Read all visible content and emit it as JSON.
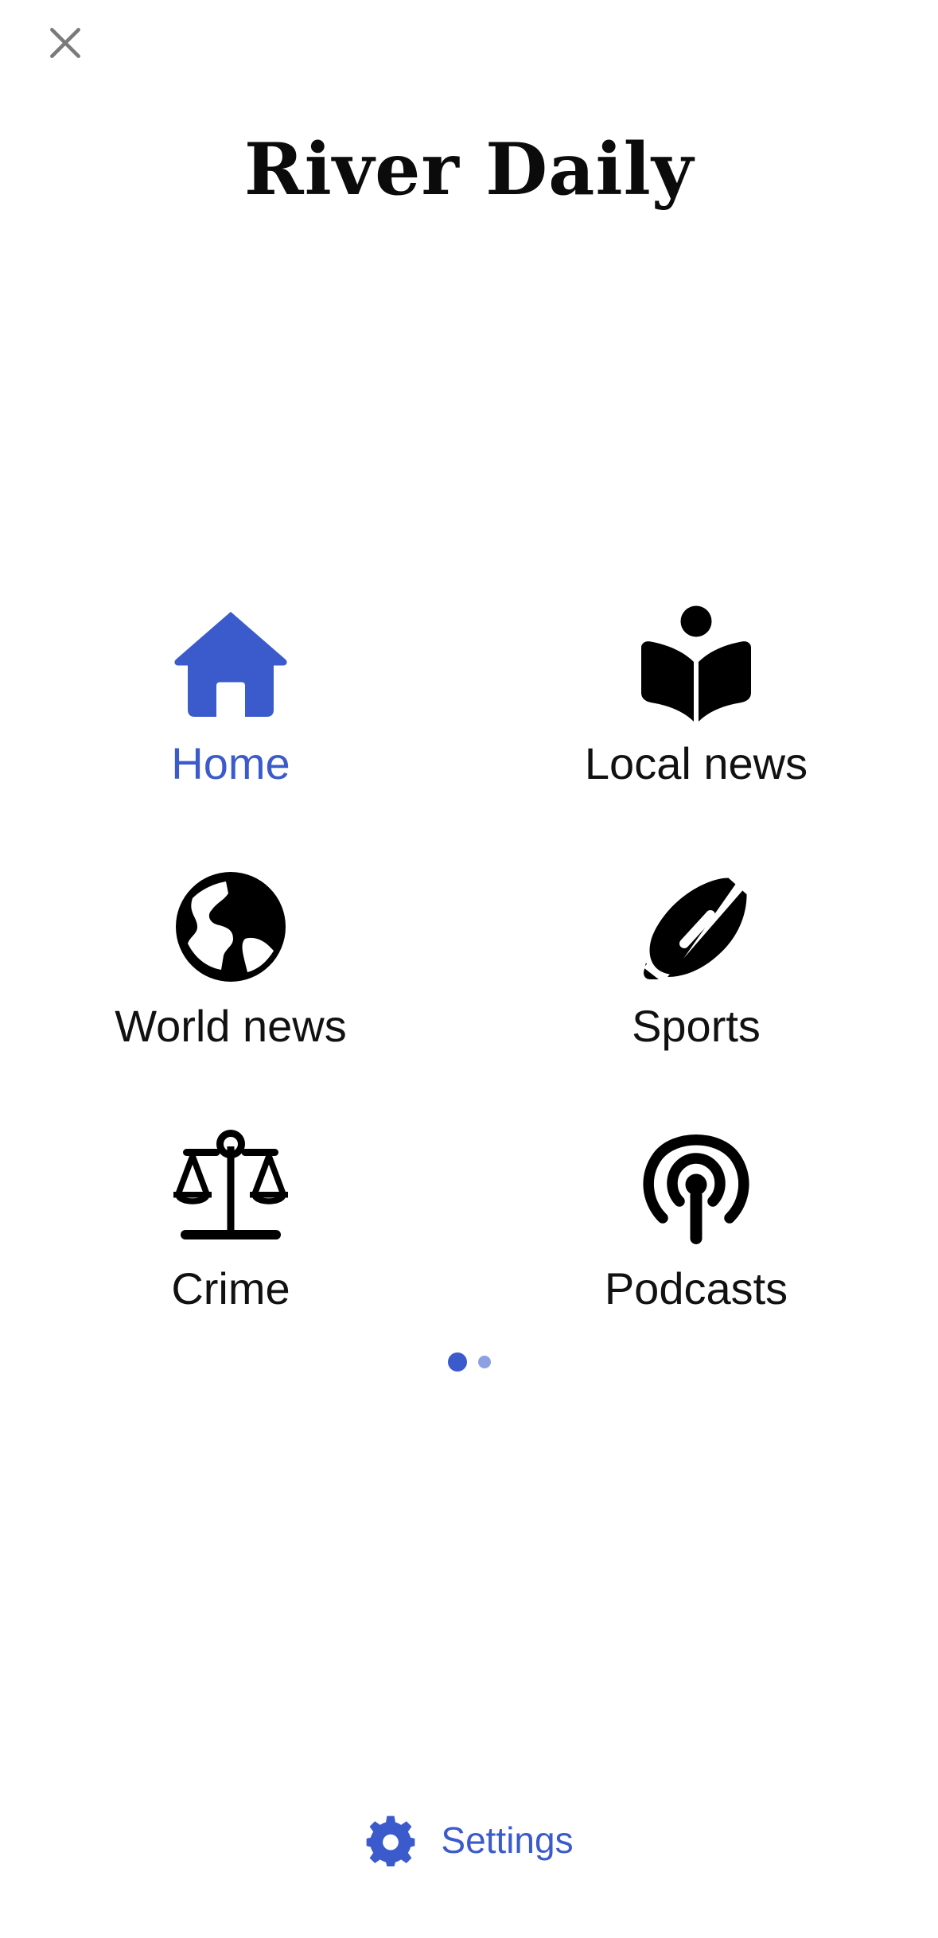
{
  "header": {
    "close_icon": "close-icon",
    "title": "River Daily"
  },
  "menu": {
    "items": [
      {
        "label": "Home",
        "icon": "home-icon",
        "active": true
      },
      {
        "label": "Local news",
        "icon": "reader-book-icon",
        "active": false
      },
      {
        "label": "World news",
        "icon": "globe-icon",
        "active": false
      },
      {
        "label": "Sports",
        "icon": "football-icon",
        "active": false
      },
      {
        "label": "Crime",
        "icon": "scales-icon",
        "active": false
      },
      {
        "label": "Podcasts",
        "icon": "podcast-icon",
        "active": false
      }
    ]
  },
  "pager": {
    "pages": 2,
    "current": 1
  },
  "footer": {
    "settings_label": "Settings",
    "settings_icon": "gear-icon"
  },
  "colors": {
    "accent": "#3b5bcc",
    "accent_light": "#8da0e2",
    "text": "#111111",
    "close_icon": "#7a7a7a"
  }
}
